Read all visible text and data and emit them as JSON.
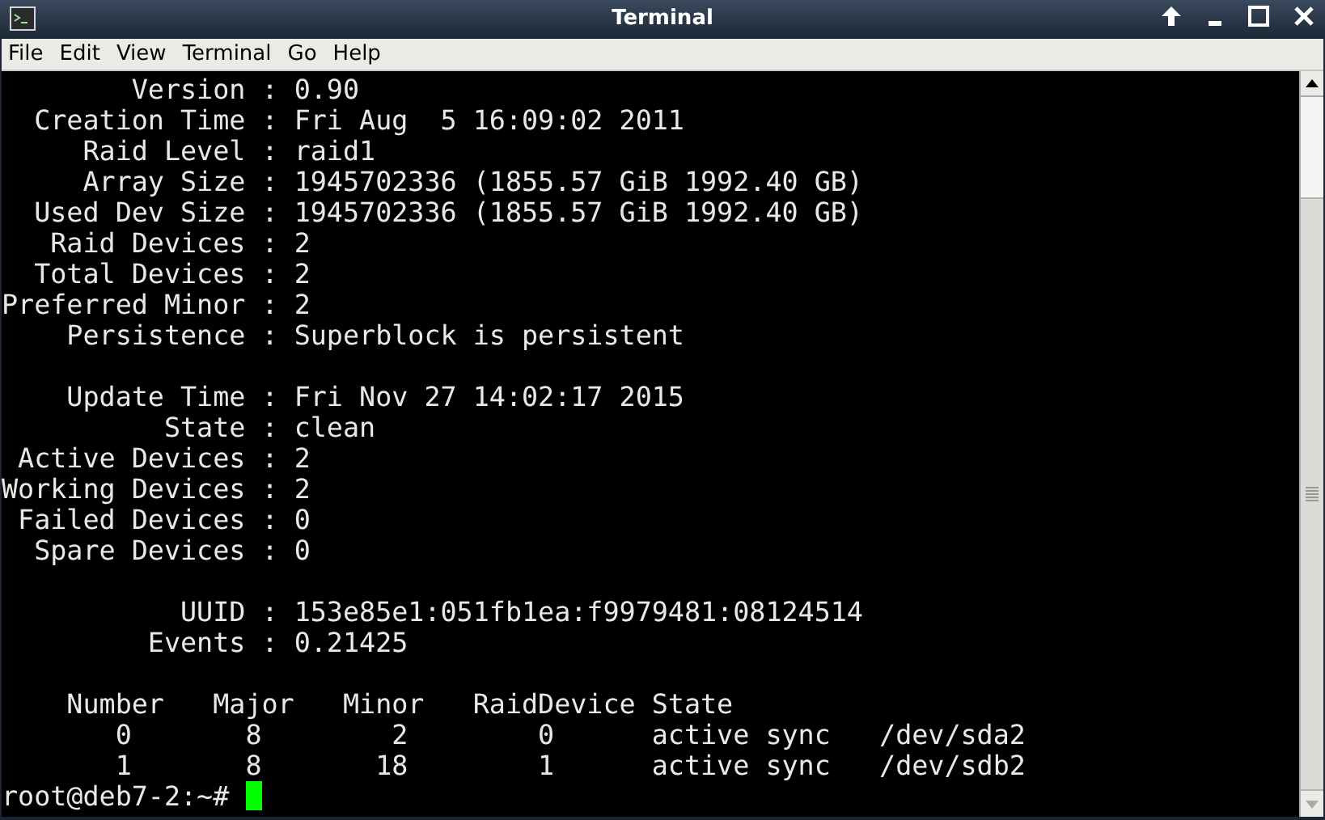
{
  "window": {
    "title": "Terminal"
  },
  "menu": [
    "File",
    "Edit",
    "View",
    "Terminal",
    "Go",
    "Help"
  ],
  "terminal": {
    "blocks": [
      [
        "        Version : 0.90",
        "  Creation Time : Fri Aug  5 16:09:02 2011",
        "     Raid Level : raid1",
        "     Array Size : 1945702336 (1855.57 GiB 1992.40 GB)",
        "  Used Dev Size : 1945702336 (1855.57 GiB 1992.40 GB)",
        "   Raid Devices : 2",
        "  Total Devices : 2",
        "Preferred Minor : 2",
        "    Persistence : Superblock is persistent"
      ],
      [
        "    Update Time : Fri Nov 27 14:02:17 2015",
        "          State : clean",
        " Active Devices : 2",
        "Working Devices : 2",
        " Failed Devices : 0",
        "  Spare Devices : 0"
      ],
      [
        "           UUID : 153e85e1:051fb1ea:f9979481:08124514",
        "         Events : 0.21425"
      ],
      [
        "    Number   Major   Minor   RaidDevice State",
        "       0       8        2        0      active sync   /dev/sda2",
        "       1       8       18        1      active sync   /dev/sdb2"
      ]
    ],
    "prompt": "root@deb7-2:~# "
  }
}
